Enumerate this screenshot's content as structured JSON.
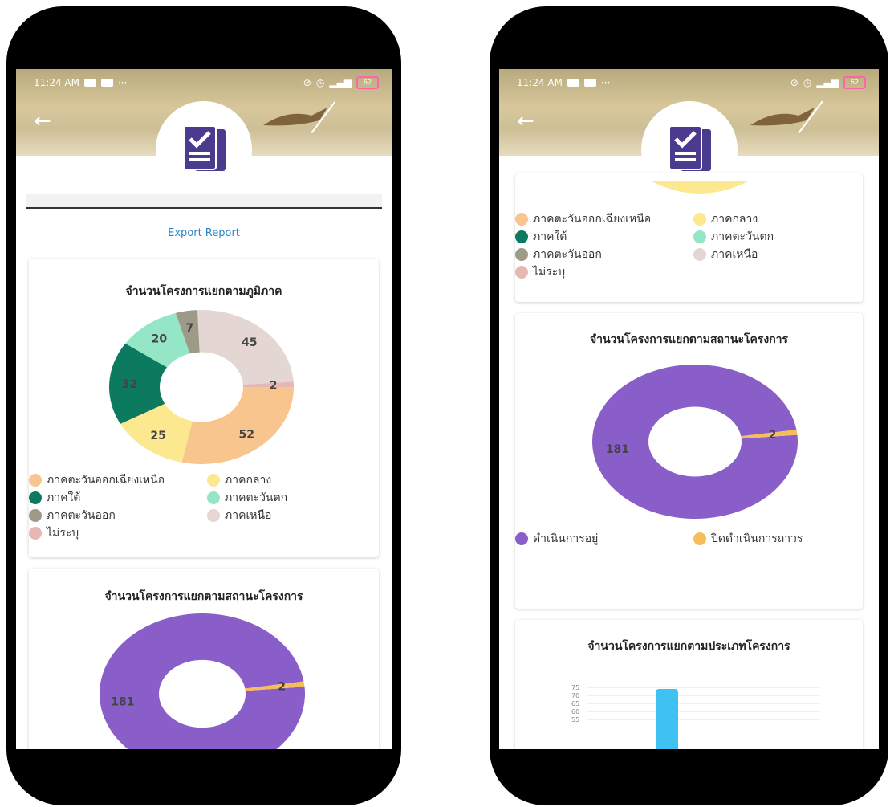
{
  "status_bar": {
    "time": "11:24 AM",
    "dots": "···",
    "battery": "62"
  },
  "export_label": "Export Report",
  "region_chart": {
    "title": "จำนวนโครงการแยกตามภูมิภาค",
    "legend": [
      {
        "label": "ภาคตะวันออกเฉียงเหนือ",
        "color": "#f9c58f"
      },
      {
        "label": "ภาคกลาง",
        "color": "#fbe88f"
      },
      {
        "label": "ภาคใต้",
        "color": "#0b7a5e"
      },
      {
        "label": "ภาคตะวันตก",
        "color": "#95e6c6"
      },
      {
        "label": "ภาคตะวันออก",
        "color": "#9d9a88"
      },
      {
        "label": "ภาคเหนือ",
        "color": "#e3d6d3"
      },
      {
        "label": "ไม่ระบุ",
        "color": "#e5b8b4"
      }
    ]
  },
  "status_chart": {
    "title": "จำนวนโครงการแยกตามสถานะโครงการ",
    "legend": [
      {
        "label": "ดำเนินการอยู่",
        "color": "#8a5ec8"
      },
      {
        "label": "ปิดดำเนินการถาวร",
        "color": "#f6bd5b"
      }
    ]
  },
  "type_chart": {
    "title": "จำนวนโครงการแยกตามประเภทโครงการ"
  },
  "chart_data": [
    {
      "type": "pie",
      "title": "จำนวนโครงการแยกตามภูมิภาค",
      "categories": [
        "ภาคตะวันออกเฉียงเหนือ",
        "ภาคกลาง",
        "ภาคใต้",
        "ภาคตะวันตก",
        "ภาคตะวันออก",
        "ภาคเหนือ",
        "ไม่ระบุ"
      ],
      "values": [
        52,
        25,
        32,
        20,
        7,
        45,
        2
      ],
      "colors": [
        "#f9c58f",
        "#fbe88f",
        "#0b7a5e",
        "#95e6c6",
        "#9d9a88",
        "#e3d6d3",
        "#e5b8b4"
      ],
      "label_colors": [
        "#333",
        "#333",
        "#333",
        "#333",
        "#333",
        "#333",
        "#333"
      ]
    },
    {
      "type": "pie",
      "title": "จำนวนโครงการแยกตามสถานะโครงการ",
      "categories": [
        "ดำเนินการอยู่",
        "ปิดดำเนินการถาวร"
      ],
      "values": [
        181,
        2
      ],
      "colors": [
        "#8a5ec8",
        "#f6bd5b"
      ],
      "label_colors": [
        "#333",
        "#333"
      ]
    },
    {
      "type": "bar",
      "title": "จำนวนโครงการแยกตามประเภทโครงการ",
      "yticks": [
        75,
        70,
        65,
        60,
        55
      ],
      "values": [
        74
      ]
    }
  ]
}
